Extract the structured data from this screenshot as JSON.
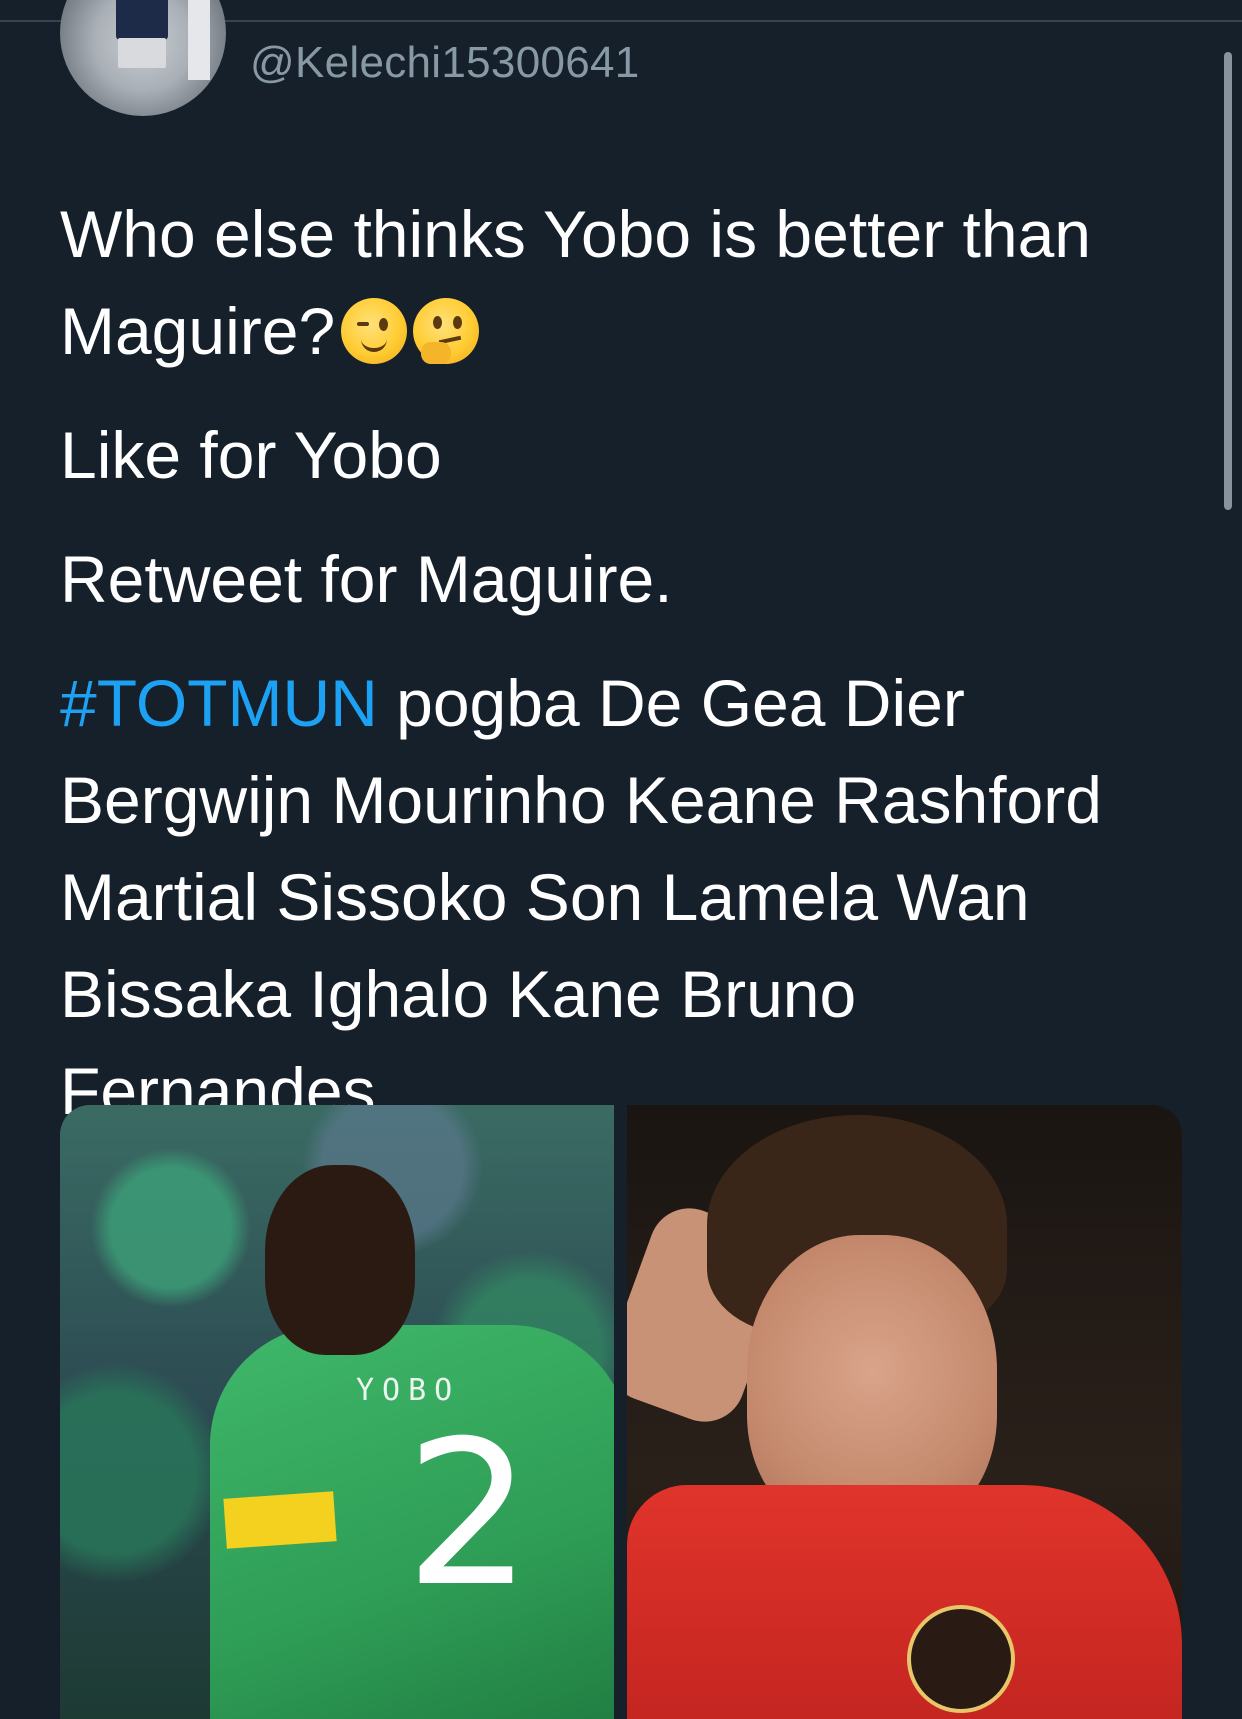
{
  "tweet": {
    "handle": "@Kelechi15300641",
    "line1": "Who else thinks Yobo is better than Maguire?",
    "line2": "Like for Yobo",
    "line3": "Retweet for Maguire.",
    "hashtag": "#TOTMUN",
    "line4_rest": " pogba De Gea Dier Bergwijn Mourinho Keane Rashford Martial Sissoko Son Lamela Wan Bissaka Ighalo Kane Bruno Fernandes",
    "emojis": [
      "winking-face",
      "thinking-face"
    ]
  },
  "media": {
    "left_photo": {
      "jersey_name": "YOBO",
      "jersey_number": "2"
    },
    "right_photo": {}
  },
  "colors": {
    "background": "#15202b",
    "text": "#ffffff",
    "secondary_text": "#8899a6",
    "hashtag": "#1da1f2"
  }
}
